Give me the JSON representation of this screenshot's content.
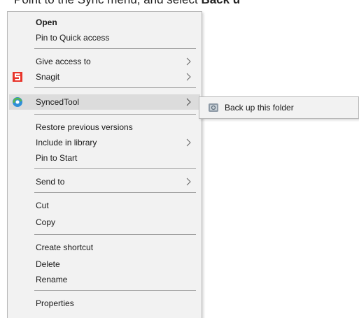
{
  "instruction": {
    "prefix": "Point to the Sync menu, and select ",
    "bold_suffix": "Back u"
  },
  "context_menu": {
    "items": [
      {
        "label": "Open"
      },
      {
        "label": "Pin to Quick access"
      },
      {
        "label": "Give access to"
      },
      {
        "label": "Snagit"
      },
      {
        "label": "SyncedTool"
      },
      {
        "label": "Restore previous versions"
      },
      {
        "label": "Include in library"
      },
      {
        "label": "Pin to Start"
      },
      {
        "label": "Send to"
      },
      {
        "label": "Cut"
      },
      {
        "label": "Copy"
      },
      {
        "label": "Create shortcut"
      },
      {
        "label": "Delete"
      },
      {
        "label": "Rename"
      },
      {
        "label": "Properties"
      }
    ]
  },
  "submenu": {
    "items": [
      {
        "label": "Back up this folder"
      }
    ]
  },
  "colors": {
    "menu_bg": "#f2f2f2",
    "highlight_bg": "#dcdcdc",
    "snagit_red": "#e8352b",
    "synced_green": "#59b84a",
    "synced_blue": "#2f8fd8"
  },
  "icons": {
    "snagit": "snagit-icon",
    "syncedtool": "syncedtool-icon",
    "backup": "backup-folder-icon",
    "chevron": "chevron-right-icon"
  }
}
